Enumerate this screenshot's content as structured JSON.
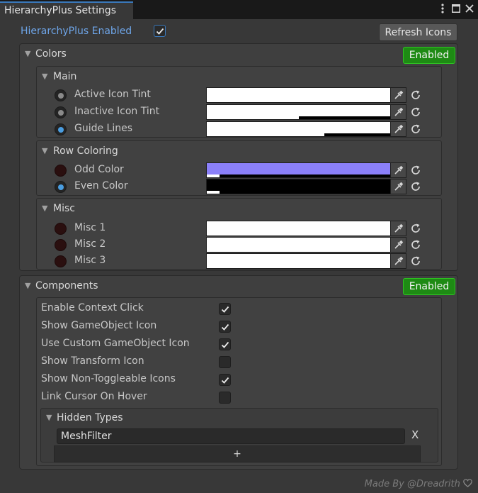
{
  "window": {
    "tab_title": "HierarchyPlus Settings",
    "menu_icon": "kebab-icon",
    "maximize_icon": "maximize-icon",
    "close_icon": "close-icon"
  },
  "top": {
    "enabled_label": "HierarchyPlus Enabled",
    "enabled_checked": true,
    "refresh_button": "Refresh Icons"
  },
  "colors": {
    "title": "Colors",
    "badge": "Enabled",
    "main": {
      "title": "Main",
      "rows": [
        {
          "label": "Active Icon Tint",
          "radio": "gray",
          "color": "#ffffff",
          "alpha": 1.0
        },
        {
          "label": "Inactive Icon Tint",
          "radio": "gray",
          "color": "#ffffff",
          "alpha": 0.5
        },
        {
          "label": "Guide Lines",
          "radio": "blue",
          "color": "#ffffff",
          "alpha": 0.35
        }
      ]
    },
    "row_coloring": {
      "title": "Row Coloring",
      "rows": [
        {
          "label": "Odd Color",
          "radio": "dark",
          "color": "#8b80f9",
          "alpha": 0.07
        },
        {
          "label": "Even Color",
          "radio": "blue",
          "color": "#000000",
          "alpha": 0.07
        }
      ]
    },
    "misc": {
      "title": "Misc",
      "rows": [
        {
          "label": "Misc 1",
          "radio": "dark",
          "color": "#ffffff",
          "alpha": 1.0
        },
        {
          "label": "Misc 2",
          "radio": "dark",
          "color": "#ffffff",
          "alpha": 1.0
        },
        {
          "label": "Misc 3",
          "radio": "dark",
          "color": "#ffffff",
          "alpha": 1.0
        }
      ]
    }
  },
  "components": {
    "title": "Components",
    "badge": "Enabled",
    "options": [
      {
        "label": "Enable Context Click",
        "checked": true
      },
      {
        "label": "Show GameObject Icon",
        "checked": true
      },
      {
        "label": "Use Custom GameObject Icon",
        "checked": true
      },
      {
        "label": "Show Transform Icon",
        "checked": false
      },
      {
        "label": "Show Non-Toggleable Icons",
        "checked": true
      },
      {
        "label": "Link Cursor On Hover",
        "checked": false
      }
    ],
    "hidden_types": {
      "title": "Hidden Types",
      "items": [
        "MeshFilter"
      ],
      "remove_label": "X",
      "add_label": "+"
    }
  },
  "footer": {
    "credit": "Made By @Dreadrith",
    "heart_icon": "heart-icon"
  },
  "theme": {
    "accent": "#3a79bb",
    "badge_green": "#1e8a14",
    "radio_blue": "#4a9de0"
  }
}
